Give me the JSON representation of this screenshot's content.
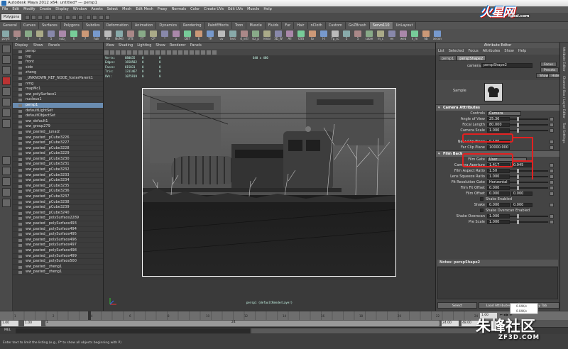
{
  "window": {
    "title": "Autodesk Maya 2012 x64: untitled*   ---   persp1"
  },
  "menus": [
    "File",
    "Edit",
    "Modify",
    "Create",
    "Display",
    "Window",
    "Assets",
    "Select",
    "Mesh",
    "Edit Mesh",
    "Proxy",
    "Normals",
    "Color",
    "Create UVs",
    "Edit UVs",
    "Muscle",
    "Help"
  ],
  "status": {
    "mode": "Polygons"
  },
  "shelf_tabs": [
    {
      "label": "General",
      "active": false
    },
    {
      "label": "Curves",
      "active": false
    },
    {
      "label": "Surfaces",
      "active": false
    },
    {
      "label": "Polygons",
      "active": false
    },
    {
      "label": "Subdivs",
      "active": false
    },
    {
      "label": "Deformation",
      "active": false
    },
    {
      "label": "Animation",
      "active": false
    },
    {
      "label": "Dynamics",
      "active": false
    },
    {
      "label": "Rendering",
      "active": false
    },
    {
      "label": "PaintEffects",
      "active": false
    },
    {
      "label": "Toon",
      "active": false
    },
    {
      "label": "Muscle",
      "active": false
    },
    {
      "label": "Fluids",
      "active": false
    },
    {
      "label": "Fur",
      "active": false
    },
    {
      "label": "Hair",
      "active": false
    },
    {
      "label": "nCloth",
      "active": false
    },
    {
      "label": "Custom",
      "active": false
    },
    {
      "label": "GoZBrush",
      "active": false
    },
    {
      "label": "Servo110",
      "active": true
    },
    {
      "label": "UnLayout",
      "active": false
    }
  ],
  "shelf_tools": [
    "polyS",
    "2",
    "3",
    "4",
    "5",
    "nub_",
    "6",
    "7",
    "hair",
    "Ma",
    "NoMd",
    "UTE",
    "FT",
    "CP",
    "*",
    "a",
    "DET",
    "6",
    "TR",
    "uv",
    "text",
    "d_vrtl",
    "siz_p",
    "renar",
    "3D_W",
    "All",
    "OSS",
    "to",
    "l-t",
    "Tp_sc",
    "5",
    "5",
    "cable",
    "m_c",
    "ev",
    "web",
    "n_m",
    "hb",
    "xecon"
  ],
  "outliner": {
    "menu": [
      "Display",
      "Show",
      "Panels"
    ],
    "items": [
      {
        "label": "persp",
        "selected": false
      },
      {
        "label": "top",
        "selected": false
      },
      {
        "label": "front",
        "selected": false
      },
      {
        "label": "side",
        "selected": false
      },
      {
        "label": "zheng",
        "selected": false
      },
      {
        "label": "_UNKNOWN_REF_NODE_fosterParent1",
        "selected": false
      },
      {
        "label": "nmg",
        "selected": false
      },
      {
        "label": "mapMc1",
        "selected": false
      },
      {
        "label": "ww_polySurface1",
        "selected": false
      },
      {
        "label": "nucleus1",
        "selected": false
      },
      {
        "label": "persp1",
        "selected": true
      },
      {
        "label": "defaultLightSet",
        "selected": false
      },
      {
        "label": "defaultObjectSet",
        "selected": false
      },
      {
        "label": "ww_default1",
        "selected": false
      },
      {
        "label": "ww_group279",
        "selected": false
      },
      {
        "label": "ww_pasted__junai2",
        "selected": false
      },
      {
        "label": "ww_pasted__pCube3226",
        "selected": false
      },
      {
        "label": "ww_pasted__pCube3227",
        "selected": false
      },
      {
        "label": "ww_pasted__pCube3228",
        "selected": false
      },
      {
        "label": "ww_pasted__pCube3229",
        "selected": false
      },
      {
        "label": "ww_pasted__pCube3230",
        "selected": false
      },
      {
        "label": "ww_pasted__pCube3231",
        "selected": false
      },
      {
        "label": "ww_pasted__pCube3232",
        "selected": false
      },
      {
        "label": "ww_pasted__pCube3233",
        "selected": false
      },
      {
        "label": "ww_pasted__pCube3234",
        "selected": false
      },
      {
        "label": "ww_pasted__pCube3235",
        "selected": false
      },
      {
        "label": "ww_pasted__pCube3236",
        "selected": false
      },
      {
        "label": "ww_pasted__pCube3237",
        "selected": false
      },
      {
        "label": "ww_pasted__pCube3238",
        "selected": false
      },
      {
        "label": "ww_pasted__pCube3239",
        "selected": false
      },
      {
        "label": "ww_pasted__pCube3240",
        "selected": false
      },
      {
        "label": "ww_pasted__polySurface2289",
        "selected": false
      },
      {
        "label": "ww_pasted__polySurface493",
        "selected": false
      },
      {
        "label": "ww_pasted__polySurface494",
        "selected": false
      },
      {
        "label": "ww_pasted__polySurface495",
        "selected": false
      },
      {
        "label": "ww_pasted__polySurface496",
        "selected": false
      },
      {
        "label": "ww_pasted__polySurface497",
        "selected": false
      },
      {
        "label": "ww_pasted__polySurface498",
        "selected": false
      },
      {
        "label": "ww_pasted__polySurface499",
        "selected": false
      },
      {
        "label": "ww_pasted__polySurface500",
        "selected": false
      },
      {
        "label": "ww_pasted__zheng1",
        "selected": false
      },
      {
        "label": "ww_pasted__zheng1",
        "selected": false
      }
    ]
  },
  "viewport": {
    "menu": [
      "View",
      "Shading",
      "Lighting",
      "Show",
      "Renderer",
      "Panels"
    ],
    "hud": [
      {
        "label": "Verts:",
        "v1": "880635",
        "v2": "0",
        "v3": "0"
      },
      {
        "label": "Edges:",
        "v1": "1658582",
        "v2": "0",
        "v3": "0"
      },
      {
        "label": "Faces:",
        "v1": "815831",
        "v2": "0",
        "v3": "0"
      },
      {
        "label": "Tris:",
        "v1": "1311467",
        "v2": "0",
        "v3": "0"
      },
      {
        "label": "UVs:",
        "v1": "1075919",
        "v2": "0",
        "v3": "0"
      }
    ],
    "resolution": "640 x 480",
    "camera_label": "persp1 (defaultRenderLayer)"
  },
  "attribute_editor": {
    "title": "Attribute Editor",
    "menu": [
      "List",
      "Selected",
      "Focus",
      "Attributes",
      "Show",
      "Help"
    ],
    "tabs": [
      {
        "label": "persp1",
        "active": false
      },
      {
        "label": "perspShape2",
        "active": true
      }
    ],
    "node_type": "camera:",
    "node_name": "perspShape2",
    "buttons": [
      "Focus",
      "Presets",
      "Show",
      "Hide"
    ],
    "sample_label": "Sample",
    "sections": {
      "camera": "Camera Attributes",
      "film": "Film Back"
    },
    "controls": {
      "label": "Controls",
      "value": "Camera"
    },
    "camera_rows": [
      {
        "label": "Angle of View",
        "value": "25.36"
      },
      {
        "label": "Focal Length",
        "value": "80.000"
      },
      {
        "label": "Camera Scale",
        "value": "1.000"
      }
    ],
    "clip_rows": [
      {
        "label": "Near Clip Plane",
        "value": "0.100"
      },
      {
        "label": "Far Clip Plane",
        "value": "10000.000"
      }
    ],
    "film_gate": {
      "label": "Film Gate",
      "value": "User"
    },
    "film_rows": [
      {
        "label": "Camera Aperture",
        "v1": "1.417",
        "v2": "0.945"
      },
      {
        "label": "Film Aspect Ratio",
        "v1": "1.50",
        "v2": ""
      },
      {
        "label": "Lens Squeeze Ratio",
        "v1": "1.000",
        "v2": ""
      },
      {
        "label": "Fit Resolution Gate",
        "v1": "Horizontal",
        "v2": ""
      },
      {
        "label": "Film Fit Offset",
        "v1": "0.000",
        "v2": ""
      },
      {
        "label": "Film Offset",
        "v1": "0.000",
        "v2": "0.000"
      },
      {
        "label": "Shake",
        "v1": "0.000",
        "v2": "0.000"
      },
      {
        "label": "Shake Overscan",
        "v1": "1.000",
        "v2": ""
      },
      {
        "label": "Pre Scale",
        "v1": "1.000",
        "v2": ""
      }
    ],
    "checkboxes": [
      "Shake Enabled",
      "Shake Overscan Enabled"
    ],
    "notes_label": "Notes: perspShape2",
    "bottom_buttons": [
      "Select",
      "Load Attributes",
      "Copy Tab"
    ]
  },
  "side_tabs": [
    "Attribute Editor",
    "Channel Box / Layer Editor",
    "Tool Settings"
  ],
  "time": {
    "tick_labels": [
      "1",
      "2",
      "4",
      "6",
      "8",
      "10",
      "12",
      "14",
      "16",
      "18",
      "20",
      "22",
      "24"
    ],
    "range_start": "1.00",
    "range_inner": "1.00",
    "frame": "1",
    "range_end": "24",
    "end_1": "24.00",
    "end_2": "48.00",
    "current": "1.00"
  },
  "net_speed": {
    "up": "0.04K/s",
    "down": "0.04K/s"
  },
  "help_line": "Enter text to limit the listing (e.g., P* to show all objects beginning with P)",
  "cmd_label": "MEL",
  "watermarks": {
    "top": "火星网",
    "top_url": "hxsd.com",
    "bottom": "朱峰社区",
    "bottom_url": "ZF3D.COM"
  }
}
